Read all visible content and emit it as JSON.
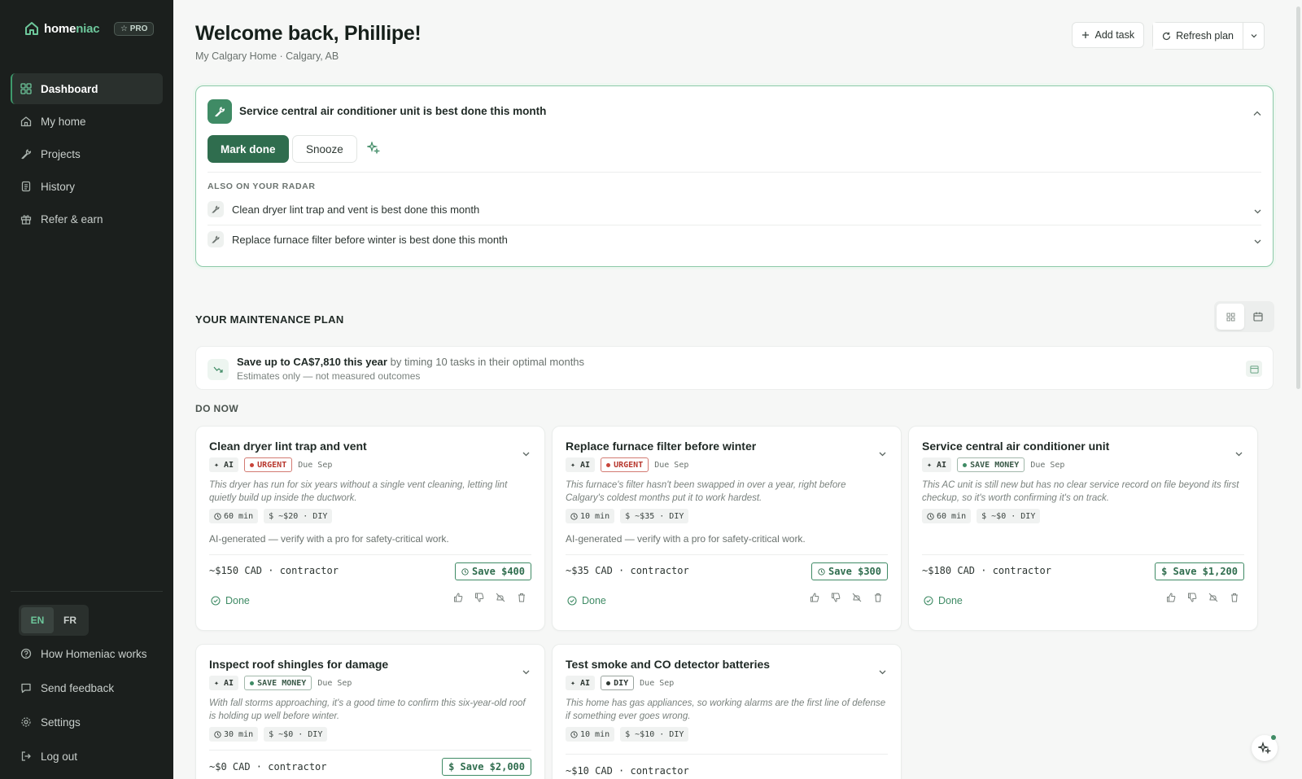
{
  "app": {
    "name_main": "home",
    "name_accent": "niac",
    "pro_badge": "☆ PRO"
  },
  "sidebar": {
    "items": [
      {
        "label": "Dashboard"
      },
      {
        "label": "My home"
      },
      {
        "label": "Projects"
      },
      {
        "label": "History"
      },
      {
        "label": "Refer & earn"
      }
    ],
    "lang": {
      "en": "EN",
      "fr": "FR",
      "active": "EN"
    },
    "bottom_items": [
      {
        "label": "How Homeniac works"
      },
      {
        "label": "Send feedback"
      },
      {
        "label": "Settings"
      },
      {
        "label": "Log out"
      }
    ]
  },
  "header": {
    "title": "Welcome back, Phillipe!",
    "subtitle": "My Calgary Home · Calgary, AB",
    "add_task": "Add task",
    "refresh_plan": "Refresh plan"
  },
  "hero": {
    "title": "Service central air conditioner unit is best done this month",
    "mark_done": "Mark done",
    "snooze": "Snooze",
    "radar_label": "ALSO ON YOUR RADAR",
    "radar": [
      {
        "text": "Clean dryer lint trap and vent is best done this month"
      },
      {
        "text": "Replace furnace filter before winter is best done this month"
      }
    ]
  },
  "plan": {
    "title": "YOUR MAINTENANCE PLAN",
    "savings_bold": "Save up to CA$7,810 this year",
    "savings_rest": " by timing 10 tasks in their optimal months",
    "savings_note": "Estimates only — not measured outcomes",
    "do_now": "DO NOW"
  },
  "cards": [
    {
      "title": "Clean dryer lint trap and vent",
      "ai": "✦ AI",
      "tag": "URGENT",
      "due": "Due Sep",
      "desc": "This dryer has run for six years without a single vent cleaning, letting lint quietly build up inside the ductwork.",
      "time": "60 min",
      "price": "$ ~$20 · DIY",
      "ai_note": "AI-generated — verify with a pro for safety-critical work.",
      "cost": "~$150 CAD · contractor",
      "save": "Save $400",
      "done": "Done"
    },
    {
      "title": "Replace furnace filter before winter",
      "ai": "✦ AI",
      "tag": "URGENT",
      "due": "Due Sep",
      "desc": "This furnace's filter hasn't been swapped in over a year, right before Calgary's coldest months put it to work hardest.",
      "time": "10 min",
      "price": "$ ~$35 · DIY",
      "ai_note": "AI-generated — verify with a pro for safety-critical work.",
      "cost": "~$35 CAD · contractor",
      "save": "Save $300",
      "done": "Done"
    },
    {
      "title": "Service central air conditioner unit",
      "ai": "✦ AI",
      "tag": "SAVE MONEY",
      "due": "Due Sep",
      "desc": "This AC unit is still new but has no clear service record on file beyond its first checkup, so it's worth confirming it's on track.",
      "time": "60 min",
      "price": "$ ~$0 · DIY",
      "cost": "~$180 CAD · contractor",
      "save": "$ Save $1,200",
      "done": "Done"
    },
    {
      "title": "Inspect roof shingles for damage",
      "ai": "✦ AI",
      "tag": "SAVE MONEY",
      "due": "Due Sep",
      "desc": "With fall storms approaching, it's a good time to confirm this six-year-old roof is holding up well before winter.",
      "time": "30 min",
      "price": "$ ~$0 · DIY",
      "cost": "~$0 CAD · contractor",
      "save": "$ Save $2,000"
    },
    {
      "title": "Test smoke and CO detector batteries",
      "ai": "✦ AI",
      "tag": "DIY",
      "due": "Due Sep",
      "desc": "This home has gas appliances, so working alarms are the first line of defense if something ever goes wrong.",
      "time": "10 min",
      "price": "$ ~$10 · DIY",
      "cost": "~$10 CAD · contractor"
    }
  ],
  "colors": {
    "sidebar_bg": "#1b1f1d",
    "accent": "#3f8b65",
    "primary_button": "#2f6d4e",
    "urgent": "#c9443a"
  }
}
